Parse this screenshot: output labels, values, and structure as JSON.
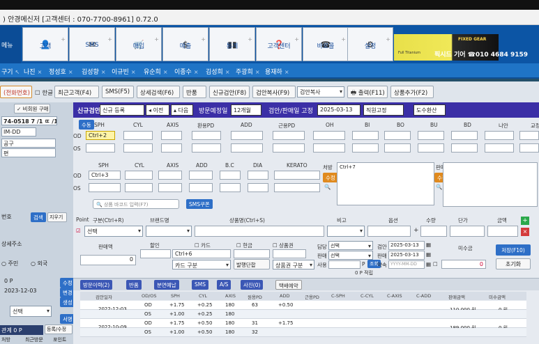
{
  "window": {
    "title": ") 안경메신저 [고객센터 : 070-7700-8961] 0.72.0"
  },
  "toolbar": {
    "side_label": "메뉴",
    "buttons": [
      {
        "label": "고객",
        "icon": "person-icon"
      },
      {
        "label": "SMS",
        "icon": "mail-icon"
      },
      {
        "label": "매입",
        "icon": "cart-icon"
      },
      {
        "label": "매출",
        "icon": "dollar-icon"
      },
      {
        "label": "통계",
        "icon": "bar-chart-icon"
      },
      {
        "label": "고객센터",
        "icon": "help-icon"
      },
      {
        "label": "바로콜",
        "icon": "phone-icon"
      },
      {
        "label": "설정",
        "icon": "gear-icon"
      }
    ],
    "banner": {
      "brand": "FIXED GEAR",
      "text": "픽시드 기어 ☎010 4684 9159",
      "small": "Full Titanium"
    }
  },
  "nav": {
    "items": [
      "구기",
      "나진",
      "정성호",
      "김성향",
      "이규빈",
      "유순희",
      "이종수",
      "김성희",
      "주광희",
      "용재하"
    ]
  },
  "action_row": {
    "left_label": "(전화번호)",
    "checkbox_label": "한글",
    "buttons": [
      "최근고객(F4)",
      "SMS(F5)",
      "상세검색(F6)",
      "반품",
      "신규검안(F8)"
    ],
    "exam_copy_label": "검안복사(F9)",
    "exam_copy_value": "검안복사",
    "print_label": "출력(F11)",
    "add_product_label": "상품추가(F2)"
  },
  "left": {
    "pw_label": "✓ 비회원 구매",
    "id_value": "74-0518 7 /1 ㄸ /1",
    "field2": "IM-DD",
    "field3": "공구",
    "field4": "편",
    "row1": "번호",
    "row1_btn": "검색",
    "row1_btn2": "지우기",
    "row2": "상세주소",
    "radio1": "주민",
    "radio2": "외국",
    "row3": "0 P",
    "date": "2023-12-03",
    "select": "선택",
    "side1": "수정",
    "side2": "변경",
    "side3": "생성",
    "side4": "서명",
    "bottom1": "관계 0 P",
    "bottom2": "등록/수정",
    "bottom3": "처방",
    "bottom4": "최근방문",
    "bottom5": "포인트"
  },
  "exam": {
    "title": "신규검안",
    "mode": "신규 등록",
    "prev": "◂ 이전",
    "next": "▴ 다음",
    "visit_label": "방문예정일",
    "visit_value": "12개월",
    "date_label": "검안/판매일 고정",
    "date_value": "2025-03-13",
    "fixed_label": "직원고정",
    "fixed_value": "",
    "help": "도수환산",
    "top_headers": [
      "SPH",
      "CYL",
      "AXIS",
      "환용PD",
      "ADD",
      "근용PD",
      "OH",
      "BI",
      "BO",
      "BU",
      "BD",
      "나안",
      "교정"
    ],
    "sub_btn": "수동",
    "od": "OD",
    "os": "OS",
    "od_sph": "Ctrl+2",
    "mid_headers": [
      "SPH",
      "CYL",
      "AXIS",
      "ADD",
      "B.C",
      "DIA",
      "KERATO"
    ],
    "od2_sph": "Ctrl+3",
    "memo_label": "처방",
    "memo_value": "Ctrl+7",
    "memo_btn": "수정",
    "sale_label": "판매",
    "sale_btn": "수정",
    "search_placeholder": "상품 바코드 입력(F7)",
    "sms_btn": "SMS쿠폰"
  },
  "product": {
    "point_label": "Point",
    "type_label": "구분(Ctrl+R)",
    "brand_label": "브랜드명",
    "name_label": "상품명(Ctrl+S)",
    "note_label": "비고",
    "option_label": "옵션",
    "qty_label": "수량",
    "price_label": "단가",
    "amount_label": "금액",
    "select_value": "선택",
    "sale_label": "판매액",
    "discount_label": "할인",
    "card_label": "카드",
    "cash_label": "현금",
    "gift_label": "상품권",
    "card_input": "Ctrl+6",
    "card_type": "카드 구분",
    "issue_type": "발행단합",
    "gift_type": "상품권 구분",
    "manager_label": "담당",
    "manager_value": "선택",
    "seller_label": "판매",
    "seller_value": "선택",
    "use_label": "사용",
    "point_p": "P",
    "point_query": "조회",
    "inspect_label": "검안",
    "inspect_date": "2025-03-13",
    "sell_label": "판매",
    "sell_date": "2025-03-13",
    "pickup_label": "약속",
    "pickup_placeholder": "YYYY-MM-DD",
    "unpaid_label": "미수금",
    "sale_total": "0",
    "unpaid_total": "0",
    "save_btn": "저장(F10)",
    "reset_btn": "초기화",
    "point_earned": "0 P 적립"
  },
  "tabs": [
    "방문이력(2)",
    "반품",
    "분면예납",
    "SMS",
    "A/S",
    "사진(0)",
    "택배예약"
  ],
  "grid": {
    "headers": [
      "검안일자",
      "OD/OS",
      "SPH",
      "CYL",
      "AXIS",
      "원용PD",
      "ADD",
      "근용PD",
      "C-SPH",
      "C-CYL",
      "C-AXIS",
      "C-ADD",
      "판매금액",
      "미수금액"
    ],
    "rows": [
      {
        "date": "2022-12-03",
        "eye": "OD",
        "sph": "+1.75",
        "cyl": "+0.25",
        "axis": "180",
        "pd": "63",
        "add": "+0.50",
        "npd": "",
        "amount": "110,000 원",
        "unpaid": "0 원"
      },
      {
        "date": "",
        "eye": "OS",
        "sph": "+1.00",
        "cyl": "+0.25",
        "axis": "180",
        "pd": "",
        "add": "",
        "npd": "",
        "amount": "",
        "unpaid": ""
      },
      {
        "date": "2022-10-09",
        "eye": "OD",
        "sph": "+1.75",
        "cyl": "+0.50",
        "axis": "180",
        "pd": "31",
        "add": "+1.75",
        "npd": "",
        "amount": "189,000 원",
        "unpaid": "0 원"
      },
      {
        "date": "",
        "eye": "OS",
        "sph": "+1.00",
        "cyl": "+0.50",
        "axis": "180",
        "pd": "32",
        "add": "",
        "npd": "",
        "amount": "",
        "unpaid": ""
      }
    ]
  }
}
